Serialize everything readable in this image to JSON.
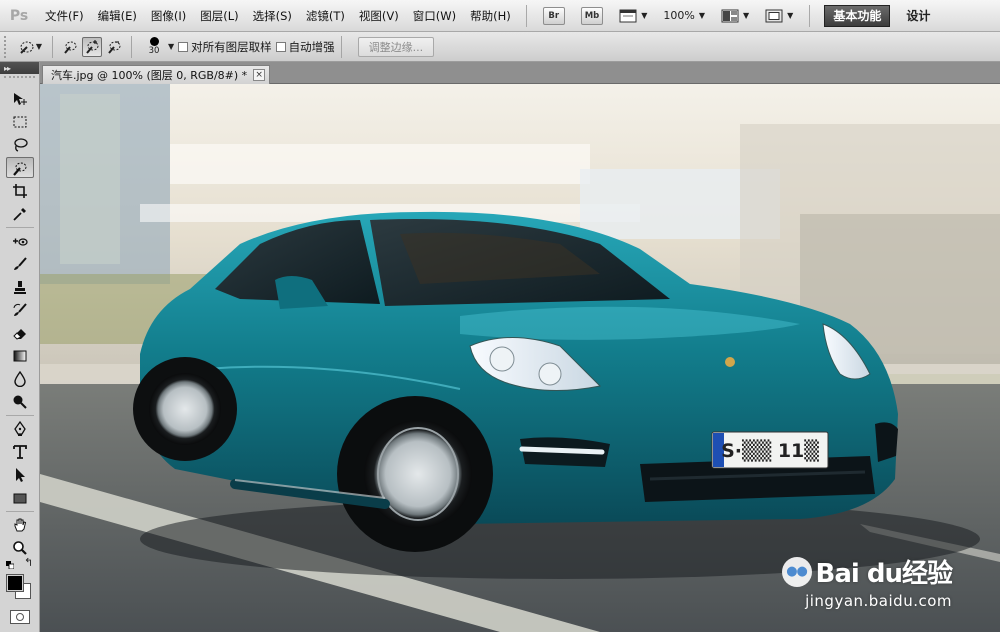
{
  "app": {
    "logo": "Ps",
    "menus": [
      "文件(F)",
      "编辑(E)",
      "图像(I)",
      "图层(L)",
      "选择(S)",
      "滤镜(T)",
      "视图(V)",
      "窗口(W)",
      "帮助(H)"
    ],
    "bridge_button": "Br",
    "minibridge_button": "Mb",
    "zoom_level": "100%",
    "workspace_active": "基本功能",
    "workspace_next": "设计"
  },
  "options": {
    "brush_size": "30",
    "sample_all_layers_label": "对所有图层取样",
    "auto_enhance_label": "自动增强",
    "refine_edge_label": "调整边缘..."
  },
  "document": {
    "tab_title": "汽车.jpg @ 100% (图层 0, RGB/8#) *",
    "close_glyph": "×"
  },
  "toolbox": {
    "collapse_glyph": "▸▸",
    "swap_glyph": "↰"
  },
  "canvas": {
    "license_plate": "S·▒▒ 11▒",
    "watermark_brand": "Bai du经验",
    "watermark_url": "jingyan.baidu.com"
  },
  "colors": {
    "foreground": "#000000",
    "background": "#ffffff",
    "car_body": "#127d8c"
  }
}
